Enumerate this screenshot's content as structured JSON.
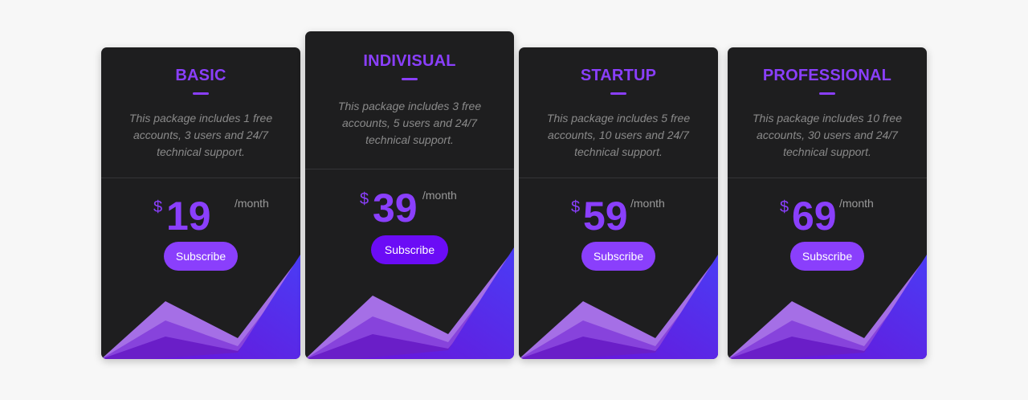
{
  "colors": {
    "accent": "#8a3ffc",
    "accent_button": "#8a3ffc",
    "featured_button": "#6b0cf6",
    "card_bg": "#1e1e1f",
    "page_bg": "#f7f7f7"
  },
  "plans": [
    {
      "name": "BASIC",
      "description": "This package includes 1 free accounts, 3 users and 24/7 technical support.",
      "currency": "$",
      "price": "19",
      "period": "/month",
      "cta": "Subscribe",
      "featured": false
    },
    {
      "name": "INDIVISUAL",
      "description": "This package includes 3 free accounts, 5 users and 24/7 technical support.",
      "currency": "$",
      "price": "39",
      "period": "/month",
      "cta": "Subscribe",
      "featured": true
    },
    {
      "name": "STARTUP",
      "description": "This package includes 5 free accounts, 10 users and 24/7 technical support.",
      "currency": "$",
      "price": "59",
      "period": "/month",
      "cta": "Subscribe",
      "featured": false
    },
    {
      "name": "PROFESSIONAL",
      "description": "This package includes 10 free accounts, 30 users and 24/7 technical support.",
      "currency": "$",
      "price": "69",
      "period": "/month",
      "cta": "Subscribe",
      "featured": false
    }
  ]
}
